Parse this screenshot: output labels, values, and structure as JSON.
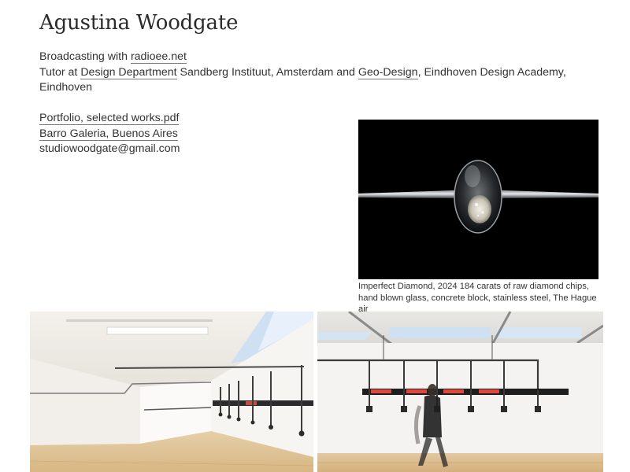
{
  "header": {
    "title": "Agustina Woodgate"
  },
  "intro": {
    "line1_prefix": "Broadcasting with ",
    "line1_link": "radioee.net",
    "line2_prefix": "Tutor at ",
    "line2_link1": "Design Department",
    "line2_mid": " Sandberg Instituut, Amsterdam and ",
    "line2_link2": "Geo-Design",
    "line2_suffix": ", Eindhoven Design Academy, Eindhoven"
  },
  "links": {
    "portfolio": "Portfolio, selected works.pdf",
    "gallery": "Barro Galeria, Buenos Aires",
    "email": "studiowoodgate@gmail.com"
  },
  "works": {
    "diamond_caption": "Imperfect Diamond, 2024 184 carats of raw diamond chips, hand blown glass, concrete block, stainless steel, The Hague air"
  }
}
